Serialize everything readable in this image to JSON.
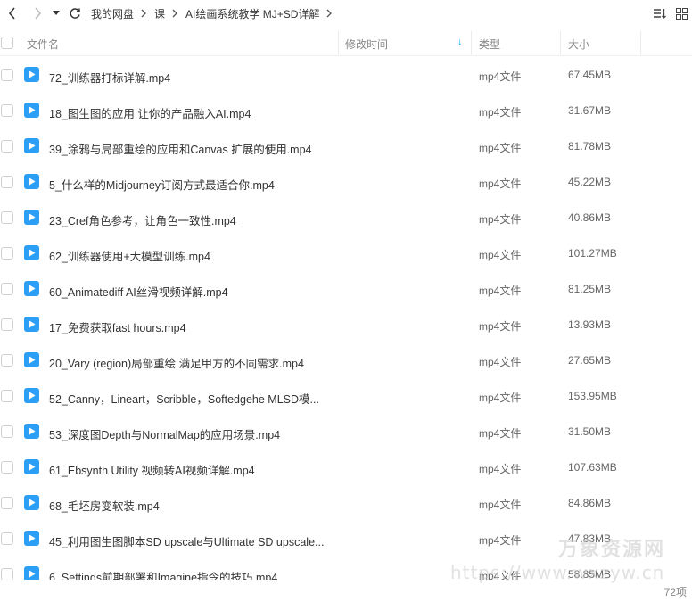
{
  "toolbar": {
    "breadcrumbs": [
      "我的网盘",
      "课",
      "AI绘画系统教学 MJ+SD详解"
    ]
  },
  "header": {
    "name": "文件名",
    "mtime": "修改时间",
    "sort_arrow": "↓",
    "type": "类型",
    "size": "大小"
  },
  "files": [
    {
      "name": "72_训练器打标详解.mp4",
      "type": "mp4文件",
      "size": "67.45MB"
    },
    {
      "name": "18_图生图的应用 让你的产品融入AI.mp4",
      "type": "mp4文件",
      "size": "31.67MB"
    },
    {
      "name": "39_涂鸦与局部重绘的应用和Canvas 扩展的使用.mp4",
      "type": "mp4文件",
      "size": "81.78MB"
    },
    {
      "name": "5_什么样的Midjourney订阅方式最适合你.mp4",
      "type": "mp4文件",
      "size": "45.22MB"
    },
    {
      "name": "23_Cref角色参考，让角色一致性.mp4",
      "type": "mp4文件",
      "size": "40.86MB"
    },
    {
      "name": "62_训练器使用+大模型训练.mp4",
      "type": "mp4文件",
      "size": "101.27MB"
    },
    {
      "name": "60_Animatediff AI丝滑视频详解.mp4",
      "type": "mp4文件",
      "size": "81.25MB"
    },
    {
      "name": "17_免费获取fast hours.mp4",
      "type": "mp4文件",
      "size": "13.93MB"
    },
    {
      "name": "20_Vary (region)局部重绘 满足甲方的不同需求.mp4",
      "type": "mp4文件",
      "size": "27.65MB"
    },
    {
      "name": "52_Canny，Lineart，Scribble，Softedgehe MLSD模...",
      "type": "mp4文件",
      "size": "153.95MB"
    },
    {
      "name": "53_深度图Depth与NormalMap的应用场景.mp4",
      "type": "mp4文件",
      "size": "31.50MB"
    },
    {
      "name": "61_Ebsynth Utility 视频转AI视频详解.mp4",
      "type": "mp4文件",
      "size": "107.63MB"
    },
    {
      "name": "68_毛坯房变软装.mp4",
      "type": "mp4文件",
      "size": "84.86MB"
    },
    {
      "name": "45_利用图生图脚本SD upscale与Ultimate SD upscale...",
      "type": "mp4文件",
      "size": "47.83MB"
    },
    {
      "name": "6_Settings前期部署和Imagine指令的技巧.mp4",
      "type": "mp4文件",
      "size": "58.85MB"
    }
  ],
  "footer": {
    "count": "72项"
  },
  "watermark": {
    "line1": "万象资源网",
    "line2": "https://www.wxzyw.cn"
  },
  "colors": {
    "accent": "#06a7ff",
    "file_icon": "#2b9ff5"
  }
}
